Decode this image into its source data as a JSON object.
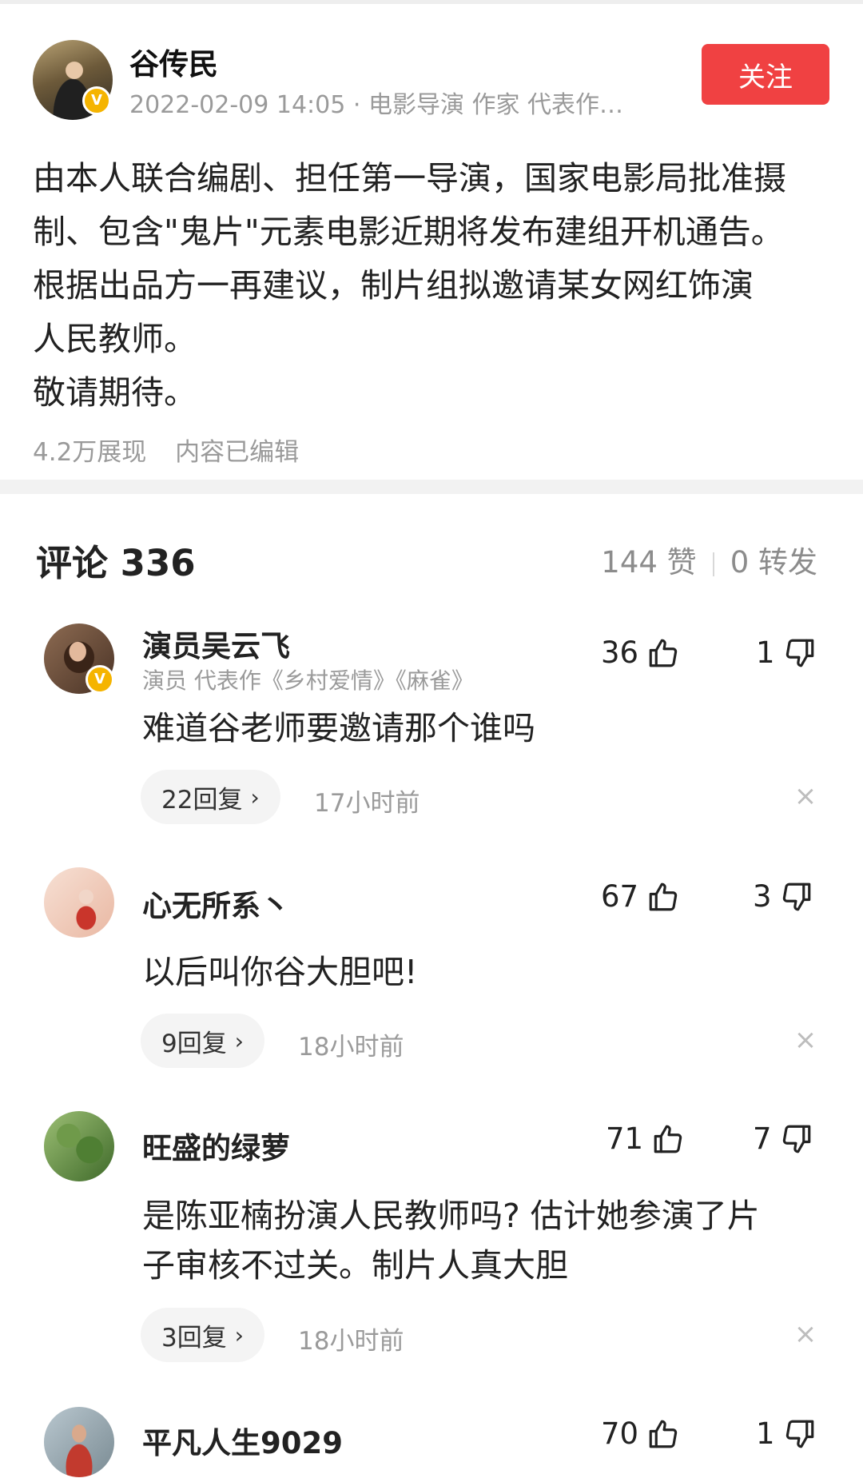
{
  "post": {
    "author": "谷传民",
    "meta": "2022-02-09 14:05 · 电影导演 作家 代表作…",
    "follow_label": "关注",
    "verified_badge": "V",
    "body_lines": [
      "由本人联合编剧、担任第一导演，国家电影局批准摄",
      "制、包含\"鬼片\"元素电影近期将发布建组开机通告。",
      "根据出品方一再建议，制片组拟邀请某女网红饰演",
      "人民教师。",
      "敬请期待。"
    ],
    "views": "4.2万展现",
    "edited": "内容已编辑"
  },
  "comments_header": {
    "title": "评论 336",
    "likes": "144 赞",
    "shares": "0 转发"
  },
  "comments": [
    {
      "name": "演员吴云飞",
      "desc": "演员 代表作《乡村爱情》《麻雀》",
      "verified_badge": "V",
      "text_lines": [
        "难道谷老师要邀请那个谁吗"
      ],
      "likes": "36",
      "dislikes": "1",
      "replies": "22回复",
      "time": "17小时前"
    },
    {
      "name": "心无所系丶",
      "text_lines": [
        "以后叫你谷大胆吧!"
      ],
      "likes": "67",
      "dislikes": "3",
      "replies": "9回复",
      "time": "18小时前"
    },
    {
      "name": "旺盛的绿萝",
      "text_lines": [
        "是陈亚楠扮演人民教师吗? 估计她参演了片",
        "子审核不过关。制片人真大胆"
      ],
      "likes": "71",
      "dislikes": "7",
      "replies": "3回复",
      "time": "18小时前"
    },
    {
      "name": "平凡人生9029",
      "likes": "70",
      "dislikes": "1"
    }
  ],
  "icons": {
    "like": "thumbs-up-icon",
    "dislike": "thumbs-down-icon",
    "reply_chevron": "chevron-right-icon",
    "dismiss": "close-icon"
  },
  "colors": {
    "follow_button": "#f04142",
    "verified_badge": "#f5b400",
    "muted_text": "#9a9a9a"
  }
}
